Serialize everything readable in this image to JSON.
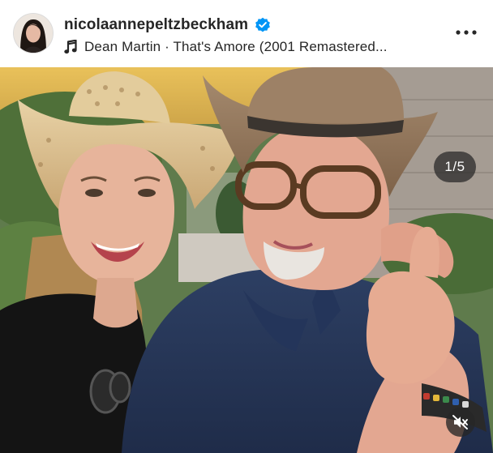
{
  "post": {
    "username": "nicolaannepeltzbeckham",
    "verified": true,
    "audio": "Dean Martin · That's Amore (2001 Remastered...",
    "carousel_counter": "1/5",
    "icons": {
      "avatar": "profile-avatar",
      "verified": "verified-badge-icon",
      "audio": "music-note-icon",
      "more": "more-options-icon",
      "mute": "speaker-muted-icon"
    },
    "colors": {
      "verified": "#0095f6",
      "text": "#262626"
    }
  }
}
